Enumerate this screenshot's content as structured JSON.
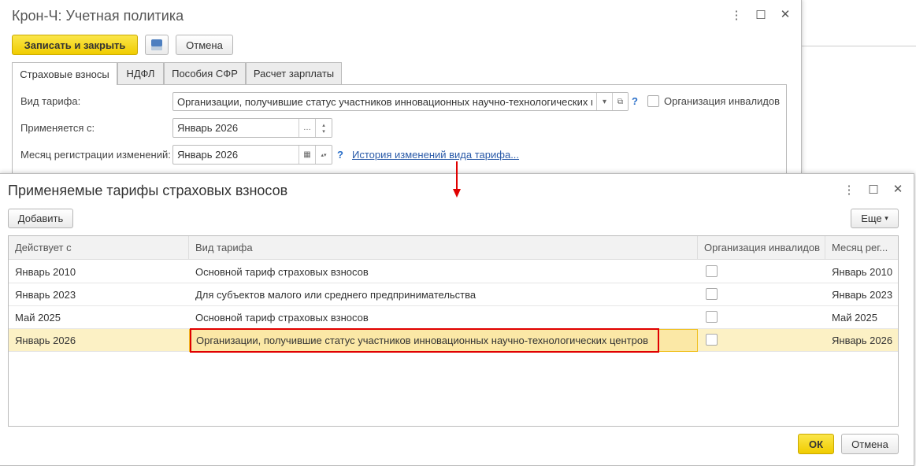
{
  "main_window": {
    "title": "Крон-Ч: Учетная политика",
    "save_close": "Записать и закрыть",
    "cancel": "Отмена",
    "tabs": [
      "Страховые взносы",
      "НДФЛ",
      "Пособия СФР",
      "Расчет зарплаты"
    ],
    "tariff_label": "Вид тарифа:",
    "tariff_value": "Организации, получившие статус участников инновационных научно-технологических ц",
    "disabled_org_label": "Организация инвалидов",
    "applied_from_label": "Применяется с:",
    "applied_from_value": "Январь 2026",
    "reg_month_label": "Месяц регистрации изменений:",
    "reg_month_value": "Январь 2026",
    "help": "?",
    "history_link": "История изменений вида тарифа..."
  },
  "dialog": {
    "title": "Применяемые тарифы страховых взносов",
    "add": "Добавить",
    "more": "Еще",
    "columns": [
      "Действует с",
      "Вид тарифа",
      "Организация инвалидов",
      "Месяц рег..."
    ],
    "rows": [
      {
        "from": "Январь 2010",
        "tariff": "Основной тариф страховых взносов",
        "disabled": false,
        "month": "Январь 2010"
      },
      {
        "from": "Январь 2023",
        "tariff": "Для субъектов малого или среднего предпринимательства",
        "disabled": false,
        "month": "Январь 2023"
      },
      {
        "from": "Май 2025",
        "tariff": "Основной тариф страховых взносов",
        "disabled": false,
        "month": "Май 2025"
      },
      {
        "from": "Январь 2026",
        "tariff": "Организации, получившие статус участников инновационных научно-технологических центров",
        "disabled": false,
        "month": "Январь 2026"
      }
    ],
    "ok": "ОК",
    "cancel": "Отмена"
  },
  "colors": {
    "accent": "#f0cc00",
    "highlight": "#e00000",
    "selected_row": "#fcf1c5"
  }
}
